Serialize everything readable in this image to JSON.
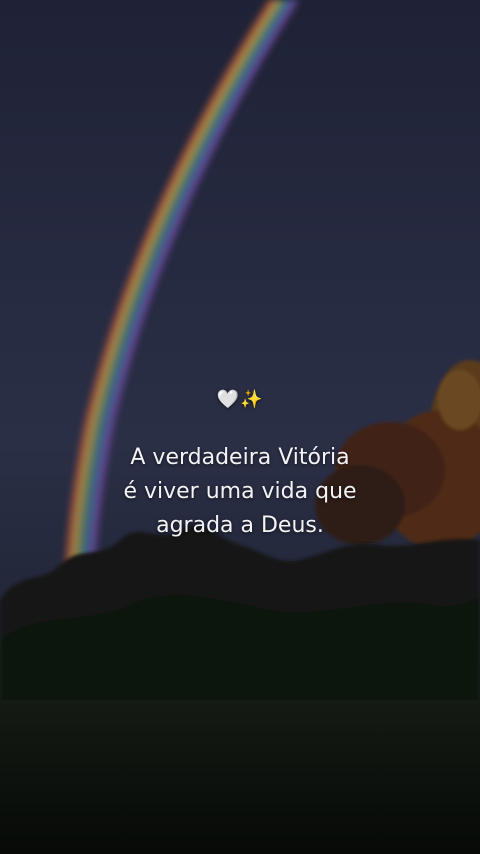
{
  "emoji_line": "🤍✨",
  "quote_lines": [
    "A verdadeira Vitória",
    "é viver uma vida que",
    "agrada a Deus."
  ],
  "colors": {
    "sky_top": "#1f2236",
    "sky_mid": "#2b2f46",
    "foliage_dark": "#0c120d",
    "autumn_tree": "#6a3a1c",
    "text": "#f4f4f6"
  }
}
